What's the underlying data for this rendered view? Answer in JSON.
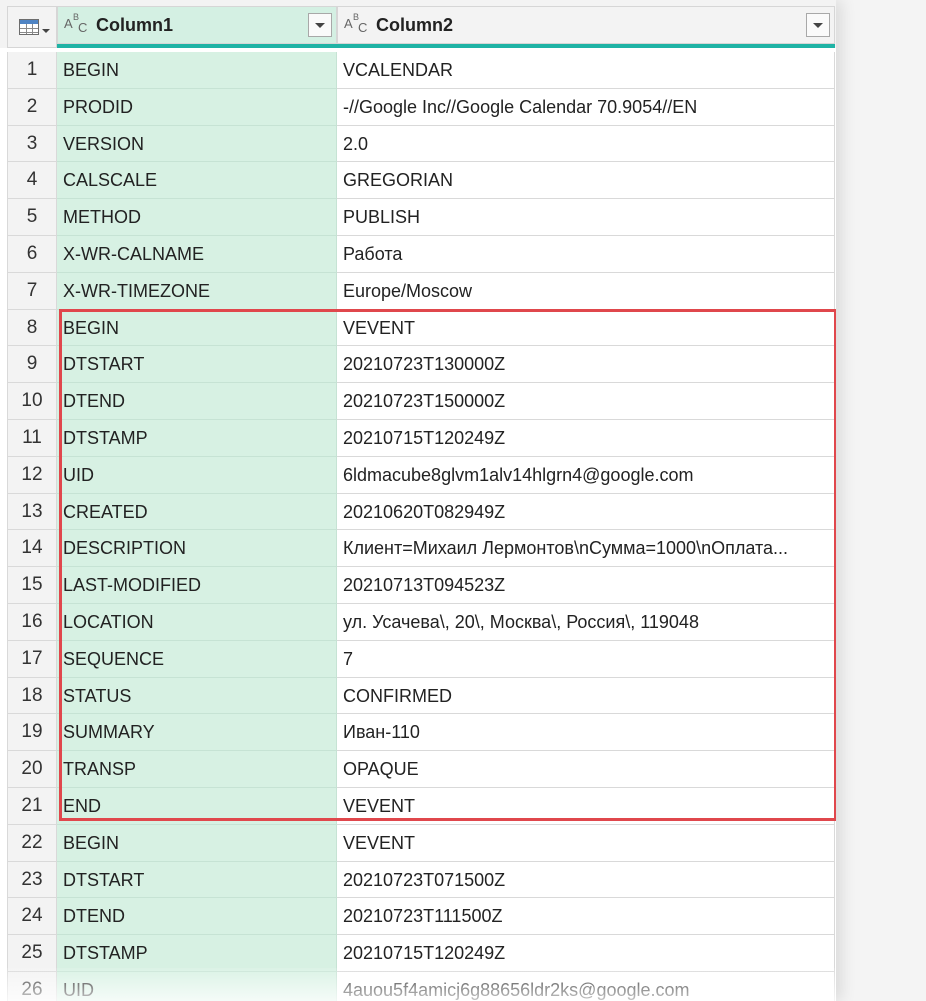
{
  "columns": [
    {
      "title": "Column1",
      "type_icon": "text-type-icon"
    },
    {
      "title": "Column2",
      "type_icon": "text-type-icon"
    }
  ],
  "type_icon_glyphs": {
    "a": "A",
    "b": "B",
    "c": "C"
  },
  "colors": {
    "column1_background": "#d7f1e3",
    "column_accent": "#1fb3a5",
    "highlight_border": "#e0474c"
  },
  "highlight_rows": [
    8,
    21
  ],
  "rows": [
    {
      "num": "1",
      "c1": "BEGIN",
      "c2": "VCALENDAR"
    },
    {
      "num": "2",
      "c1": "PRODID",
      "c2": "-//Google Inc//Google Calendar 70.9054//EN"
    },
    {
      "num": "3",
      "c1": "VERSION",
      "c2": "2.0"
    },
    {
      "num": "4",
      "c1": "CALSCALE",
      "c2": "GREGORIAN"
    },
    {
      "num": "5",
      "c1": "METHOD",
      "c2": "PUBLISH"
    },
    {
      "num": "6",
      "c1": "X-WR-CALNAME",
      "c2": "Работа"
    },
    {
      "num": "7",
      "c1": "X-WR-TIMEZONE",
      "c2": "Europe/Moscow"
    },
    {
      "num": "8",
      "c1": "BEGIN",
      "c2": "VEVENT"
    },
    {
      "num": "9",
      "c1": "DTSTART",
      "c2": "20210723T130000Z"
    },
    {
      "num": "10",
      "c1": "DTEND",
      "c2": "20210723T150000Z"
    },
    {
      "num": "11",
      "c1": "DTSTAMP",
      "c2": "20210715T120249Z"
    },
    {
      "num": "12",
      "c1": "UID",
      "c2": "6ldmacube8glvm1alv14hlgrn4@google.com"
    },
    {
      "num": "13",
      "c1": "CREATED",
      "c2": "20210620T082949Z"
    },
    {
      "num": "14",
      "c1": "DESCRIPTION",
      "c2": "Клиент=Михаил Лермонтов\\nСумма=1000\\nОплата..."
    },
    {
      "num": "15",
      "c1": "LAST-MODIFIED",
      "c2": "20210713T094523Z"
    },
    {
      "num": "16",
      "c1": "LOCATION",
      "c2": "ул. Усачева\\, 20\\, Москва\\, Россия\\, 119048"
    },
    {
      "num": "17",
      "c1": "SEQUENCE",
      "c2": "7"
    },
    {
      "num": "18",
      "c1": "STATUS",
      "c2": "CONFIRMED"
    },
    {
      "num": "19",
      "c1": "SUMMARY",
      "c2": "Иван-110"
    },
    {
      "num": "20",
      "c1": "TRANSP",
      "c2": "OPAQUE"
    },
    {
      "num": "21",
      "c1": "END",
      "c2": "VEVENT"
    },
    {
      "num": "22",
      "c1": "BEGIN",
      "c2": "VEVENT"
    },
    {
      "num": "23",
      "c1": "DTSTART",
      "c2": "20210723T071500Z"
    },
    {
      "num": "24",
      "c1": "DTEND",
      "c2": "20210723T111500Z"
    },
    {
      "num": "25",
      "c1": "DTSTAMP",
      "c2": "20210715T120249Z"
    },
    {
      "num": "26",
      "c1": "UID",
      "c2": "4auou5f4amicj6g88656ldr2ks@google.com"
    }
  ]
}
